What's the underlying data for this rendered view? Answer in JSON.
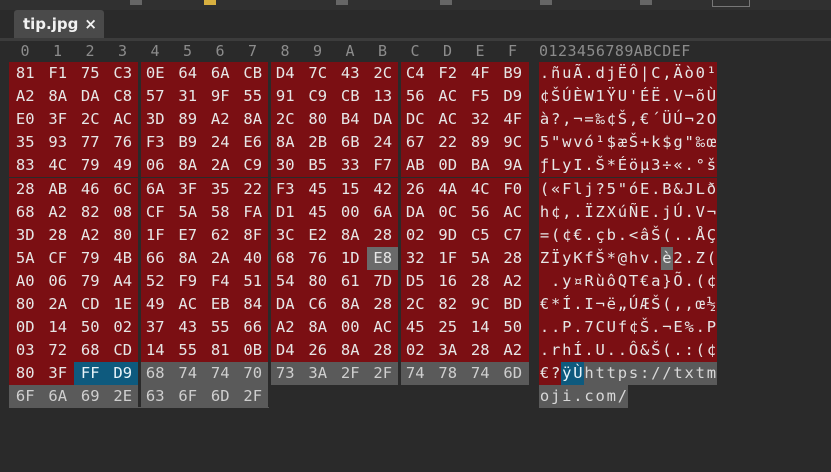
{
  "tab": {
    "title": "tip.jpg",
    "close_glyph": "×"
  },
  "hex_header": [
    "0",
    "1",
    "2",
    "3",
    "4",
    "5",
    "6",
    "7",
    "8",
    "9",
    "A",
    "B",
    "C",
    "D",
    "E",
    "F"
  ],
  "ascii_header": "0123456789ABCDEF",
  "hex_rows": [
    [
      "81",
      "F1",
      "75",
      "C3",
      "0E",
      "64",
      "6A",
      "CB",
      "D4",
      "7C",
      "43",
      "2C",
      "C4",
      "F2",
      "4F",
      "B9"
    ],
    [
      "A2",
      "8A",
      "DA",
      "C8",
      "57",
      "31",
      "9F",
      "55",
      "91",
      "C9",
      "CB",
      "13",
      "56",
      "AC",
      "F5",
      "D9"
    ],
    [
      "E0",
      "3F",
      "2C",
      "AC",
      "3D",
      "89",
      "A2",
      "8A",
      "2C",
      "80",
      "B4",
      "DA",
      "DC",
      "AC",
      "32",
      "4F"
    ],
    [
      "35",
      "93",
      "77",
      "76",
      "F3",
      "B9",
      "24",
      "E6",
      "8A",
      "2B",
      "6B",
      "24",
      "67",
      "22",
      "89",
      "9C"
    ],
    [
      "83",
      "4C",
      "79",
      "49",
      "06",
      "8A",
      "2A",
      "C9",
      "30",
      "B5",
      "33",
      "F7",
      "AB",
      "0D",
      "BA",
      "9A"
    ],
    [
      "28",
      "AB",
      "46",
      "6C",
      "6A",
      "3F",
      "35",
      "22",
      "F3",
      "45",
      "15",
      "42",
      "26",
      "4A",
      "4C",
      "F0"
    ],
    [
      "68",
      "A2",
      "82",
      "08",
      "CF",
      "5A",
      "58",
      "FA",
      "D1",
      "45",
      "00",
      "6A",
      "DA",
      "0C",
      "56",
      "AC"
    ],
    [
      "3D",
      "28",
      "A2",
      "80",
      "1F",
      "E7",
      "62",
      "8F",
      "3C",
      "E2",
      "8A",
      "28",
      "02",
      "9D",
      "C5",
      "C7"
    ],
    [
      "5A",
      "CF",
      "79",
      "4B",
      "66",
      "8A",
      "2A",
      "40",
      "68",
      "76",
      "1D",
      "E8",
      "32",
      "1F",
      "5A",
      "28"
    ],
    [
      "A0",
      "06",
      "79",
      "A4",
      "52",
      "F9",
      "F4",
      "51",
      "54",
      "80",
      "61",
      "7D",
      "D5",
      "16",
      "28",
      "A2"
    ],
    [
      "80",
      "2A",
      "CD",
      "1E",
      "49",
      "AC",
      "EB",
      "84",
      "DA",
      "C6",
      "8A",
      "28",
      "2C",
      "82",
      "9C",
      "BD"
    ],
    [
      "0D",
      "14",
      "50",
      "02",
      "37",
      "43",
      "55",
      "66",
      "A2",
      "8A",
      "00",
      "AC",
      "45",
      "25",
      "14",
      "50"
    ],
    [
      "03",
      "72",
      "68",
      "CD",
      "14",
      "55",
      "81",
      "0B",
      "D4",
      "26",
      "8A",
      "28",
      "02",
      "3A",
      "28",
      "A2"
    ],
    [
      "80",
      "3F",
      "FF",
      "D9",
      "68",
      "74",
      "74",
      "70",
      "73",
      "3A",
      "2F",
      "2F",
      "74",
      "78",
      "74",
      "6D"
    ],
    [
      "6F",
      "6A",
      "69",
      "2E",
      "63",
      "6F",
      "6D",
      "2F"
    ]
  ],
  "ascii_rows": [
    ".ñuÃ.djËÔ|C,Äò0¹",
    "¢ŠÚÈW1ŸU'ÉË.V¬õÙ",
    "à?,¬=‰¢Š,€´ÜÚ¬2O",
    "5\"wvó¹$æŠ+k$g\"‰œ",
    "ƒLyI.Š*Éöµ3÷«.°š",
    "(«Flj?5\"óE.B&JLð",
    "h¢‚.ÏZXúÑE.jÚ.V¬",
    "=(¢€.çb.<âŠ(..ÅÇ",
    "ZÏyKfŠ*@hv.è2.Z(",
    " .y¤RùôQT€a}Õ.(¢",
    "€*Í.I¬ë„ÚÆŠ(,‚œ½",
    "..P.7CUf¢Š.¬E%.P",
    ".rhÍ.U..Ô&Š(.:(¢",
    "€?ÿÙhttps://txtm",
    "oji.com/"
  ],
  "colors": {
    "file_body": "#7b0f13",
    "eoi_marker": "#0e5a7e",
    "appended": "#5a5a5a",
    "background": "#2a2a2a"
  },
  "icons": {
    "close": "close-icon"
  }
}
